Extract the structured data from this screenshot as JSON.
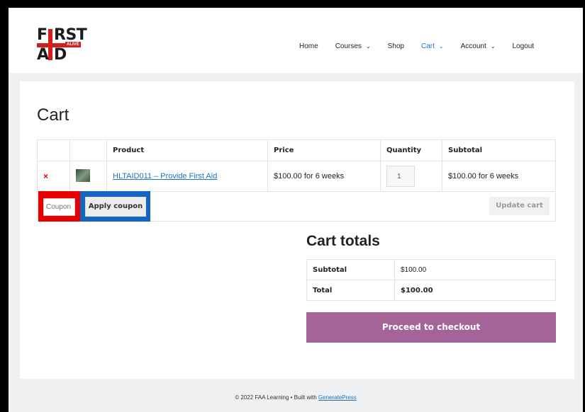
{
  "logo": {
    "line1_a": "F",
    "line1_b": "RST",
    "line2_a": "A",
    "line2_b": "D",
    "badge": "ALIVE",
    "brand_red": "#d11f1f"
  },
  "nav": {
    "items": [
      {
        "label": "Home",
        "chevron": false
      },
      {
        "label": "Courses",
        "chevron": true
      },
      {
        "label": "Shop",
        "chevron": false
      },
      {
        "label": "Cart",
        "chevron": true,
        "active": true
      },
      {
        "label": "Account",
        "chevron": true
      },
      {
        "label": "Logout",
        "chevron": false
      }
    ],
    "chevron_glyph": "⌄",
    "active_color": "#1e73be"
  },
  "page": {
    "title": "Cart"
  },
  "cart_table": {
    "headers": [
      "",
      "",
      "Product",
      "Price",
      "Quantity",
      "Subtotal"
    ],
    "rows": [
      {
        "remove": "×",
        "thumb_icon": "course-thumbnail",
        "product": "HLTAID011 – Provide First Aid",
        "price": "$100.00 for 6 weeks",
        "quantity": "1",
        "subtotal": "$100.00 for 6 weeks"
      }
    ]
  },
  "coupon": {
    "placeholder": "Coupon",
    "apply_label": "Apply coupon",
    "highlight_color": "#e80000",
    "apply_highlight_color": "#1465c0"
  },
  "update_label": "Update cart",
  "totals": {
    "title": "Cart totals",
    "rows": [
      {
        "label": "Subtotal",
        "value": "$100.00"
      },
      {
        "label": "Total",
        "value": "$100.00"
      }
    ]
  },
  "checkout": {
    "label": "Proceed to checkout",
    "color": "#a46497"
  },
  "footer": {
    "text": "© 2022 FAA Learning • Built with ",
    "link": "GeneratePress"
  }
}
